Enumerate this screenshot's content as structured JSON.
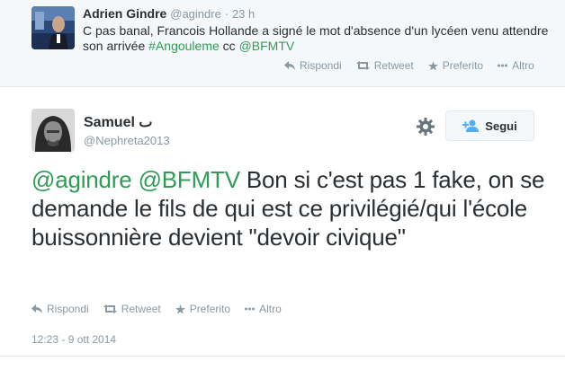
{
  "parent_tweet": {
    "name": "Adrien Gindre",
    "handle": "@agindre",
    "separator": "·",
    "time": "23 h",
    "text_before": "C pas banal, Francois Hollande a signé le mot d'absence d'un lycéen venu attendre son arrivée ",
    "hashtag": "#Angouleme",
    "text_mid": " cc ",
    "mention": "@BFMTV",
    "actions": {
      "reply": "Rispondi",
      "retweet": "Retweet",
      "favorite": "Preferito",
      "more": "Altro"
    }
  },
  "main_tweet": {
    "name": "Samuel ٮ",
    "handle": "@Nephreta2013",
    "follow_label": "Segui",
    "mention1": "@agindre",
    "mention2": "@BFMTV",
    "text": " Bon si c'est pas 1 fake, on se demande le fils de qui est ce privilégié/qui l'école buissonnière devient \"devoir civique\"",
    "actions": {
      "reply": "Rispondi",
      "retweet": "Retweet",
      "favorite": "Preferito",
      "more": "Altro"
    },
    "date": "12:23 - 9 ott 2014"
  },
  "colors": {
    "link": "#2f9c55",
    "meta": "#8899a6",
    "text": "#292f33"
  },
  "icons": [
    "reply-icon",
    "retweet-icon",
    "star-icon",
    "more-icon",
    "gear-icon",
    "follow-user-icon"
  ]
}
